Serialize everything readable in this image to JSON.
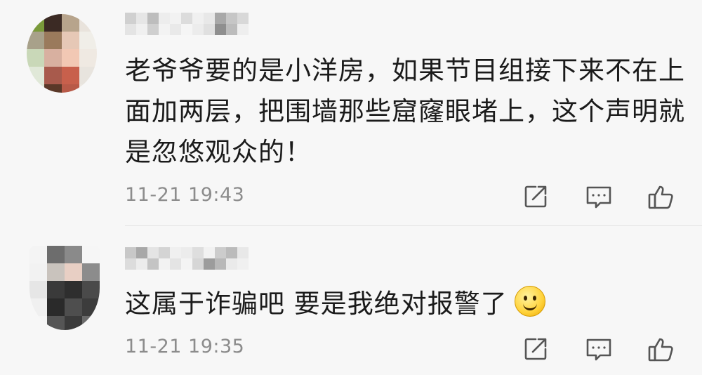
{
  "comments": [
    {
      "text": "老爷爷要的是小洋房，如果节目组接下来不在上面加两层，把围墙那些窟窿眼堵上，这个声明就是忽悠观众的！",
      "time": "11-21 19:43",
      "emoji": null
    },
    {
      "text": "这属于诈骗吧 要是我绝对报警了",
      "time": "11-21 19:35",
      "emoji": "smile-emoji"
    }
  ],
  "icons": {
    "share": "share-icon",
    "reply": "comment-icon",
    "like": "thumbs-up-icon"
  },
  "colors": {
    "background": "#f7f7f7",
    "text": "#1b1b1b",
    "timestamp": "#8c8c8c",
    "icon": "#555555",
    "emoji": "#ffd23a"
  }
}
